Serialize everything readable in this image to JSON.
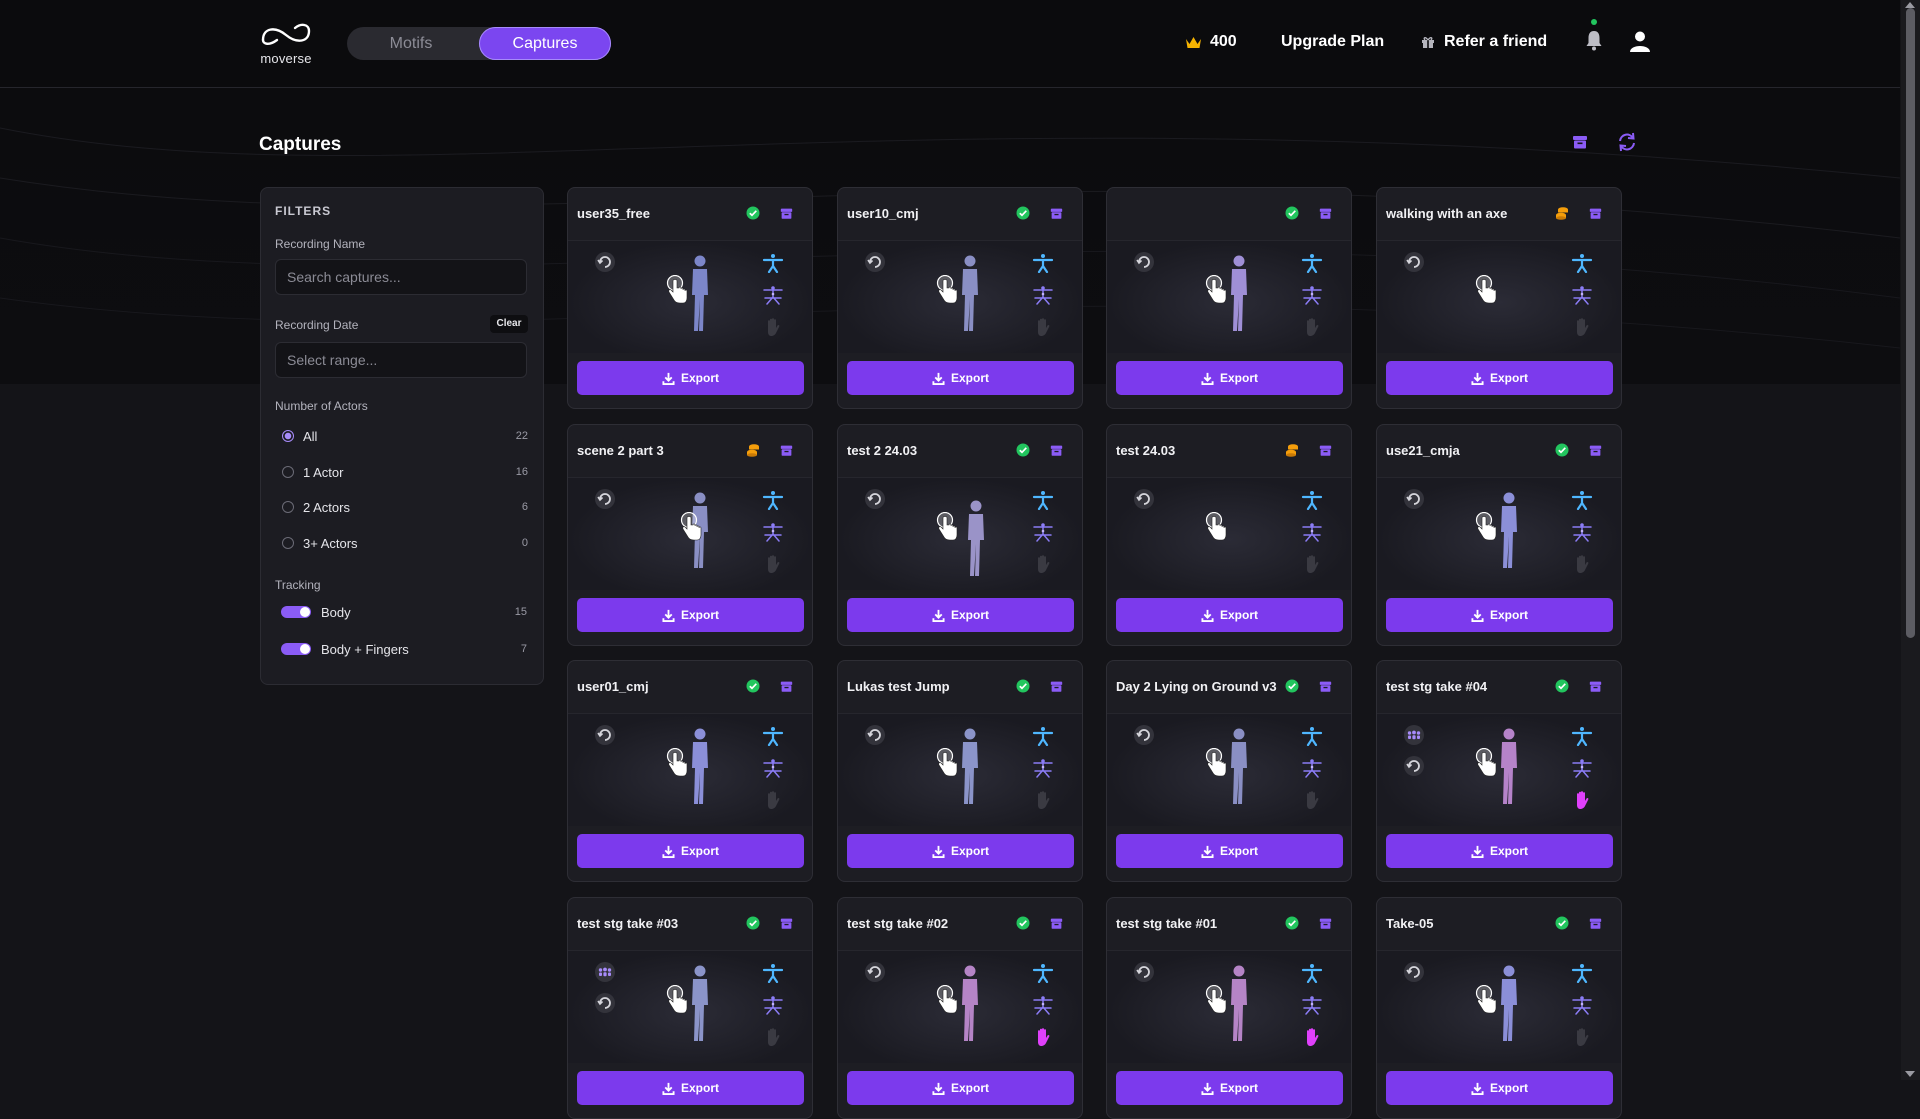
{
  "app": {
    "logo_text": "moverse",
    "tabs": [
      "Motifs",
      "Captures"
    ],
    "active_tab": "Captures",
    "credits": "400",
    "upgrade_label": "Upgrade Plan",
    "refer_label": "Refer a friend",
    "accent": "#7c3aed",
    "success_color": "#22c55e",
    "pending_color": "#f59e0b"
  },
  "page": {
    "title": "Captures"
  },
  "filters": {
    "title": "FILTERS",
    "name_label": "Recording Name",
    "name_placeholder": "Search captures...",
    "date_label": "Recording Date",
    "clear_label": "Clear",
    "date_placeholder": "Select range...",
    "actors_label": "Number of Actors",
    "actors": [
      {
        "label": "All",
        "count": "22",
        "selected": true
      },
      {
        "label": "1 Actor",
        "count": "16",
        "selected": false
      },
      {
        "label": "2 Actors",
        "count": "6",
        "selected": false
      },
      {
        "label": "3+ Actors",
        "count": "0",
        "selected": false
      }
    ],
    "tracking_label": "Tracking",
    "tracking": [
      {
        "label": "Body",
        "count": "15",
        "on": true
      },
      {
        "label": "Body + Fingers",
        "count": "7",
        "on": true
      }
    ]
  },
  "export_label": "Export",
  "captures": [
    {
      "name": "user35_free",
      "status": "done",
      "fingers": false,
      "multi": false
    },
    {
      "name": "user10_cmj",
      "status": "done",
      "fingers": false,
      "multi": false
    },
    {
      "name": "",
      "status": "done",
      "fingers": false,
      "multi": false
    },
    {
      "name": "walking with an axe",
      "status": "processing",
      "fingers": false,
      "multi": false
    },
    {
      "name": "scene 2 part 3",
      "status": "processing",
      "fingers": false,
      "multi": false
    },
    {
      "name": "test 2 24.03",
      "status": "done",
      "fingers": false,
      "multi": false
    },
    {
      "name": "test 24.03",
      "status": "processing",
      "fingers": false,
      "multi": false
    },
    {
      "name": "use21_cmja",
      "status": "done",
      "fingers": false,
      "multi": false
    },
    {
      "name": "user01_cmj",
      "status": "done",
      "fingers": false,
      "multi": false
    },
    {
      "name": "Lukas test Jump",
      "status": "done",
      "fingers": false,
      "multi": false
    },
    {
      "name": "Day 2 Lying on Ground v3",
      "status": "done",
      "fingers": false,
      "multi": false
    },
    {
      "name": "test stg take #04",
      "status": "done",
      "fingers": true,
      "multi": true
    },
    {
      "name": "test stg take #03",
      "status": "done",
      "fingers": false,
      "multi": true
    },
    {
      "name": "test stg take #02",
      "status": "done",
      "fingers": true,
      "multi": false
    },
    {
      "name": "test stg take #01",
      "status": "done",
      "fingers": true,
      "multi": false
    },
    {
      "name": "Take-05",
      "status": "done",
      "fingers": false,
      "multi": false
    }
  ]
}
